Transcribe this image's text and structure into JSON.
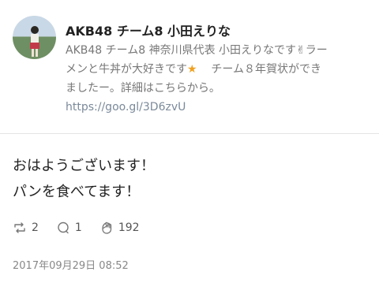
{
  "profile": {
    "username": "AKB48 チーム8 小田えりな",
    "bio_lines": [
      "AKB48 チーム8 神奈川県代表 小田えりなです✌ラー",
      "メンと牛丼が大好きです",
      "チーム８年賀状ができ",
      "ましたー。詳細はこちらから。"
    ],
    "bio_link": "https://goo.gl/3D6zvU"
  },
  "post": {
    "lines": [
      "おはようございます！",
      "パンを食べてます！"
    ],
    "stats": {
      "reposts": "2",
      "comments": "1",
      "likes": "192"
    },
    "timestamp": "2017年09月29日 08:52"
  },
  "icons": {
    "avatar": "avatar-photo",
    "repost": "repost-icon",
    "comment": "comment-icon",
    "like": "clap-hand-icon",
    "star": "star-emoji-icon"
  },
  "colors": {
    "text": "#222222",
    "muted": "#777777",
    "link": "#7b8a9a",
    "divider": "#e4e4e4"
  }
}
